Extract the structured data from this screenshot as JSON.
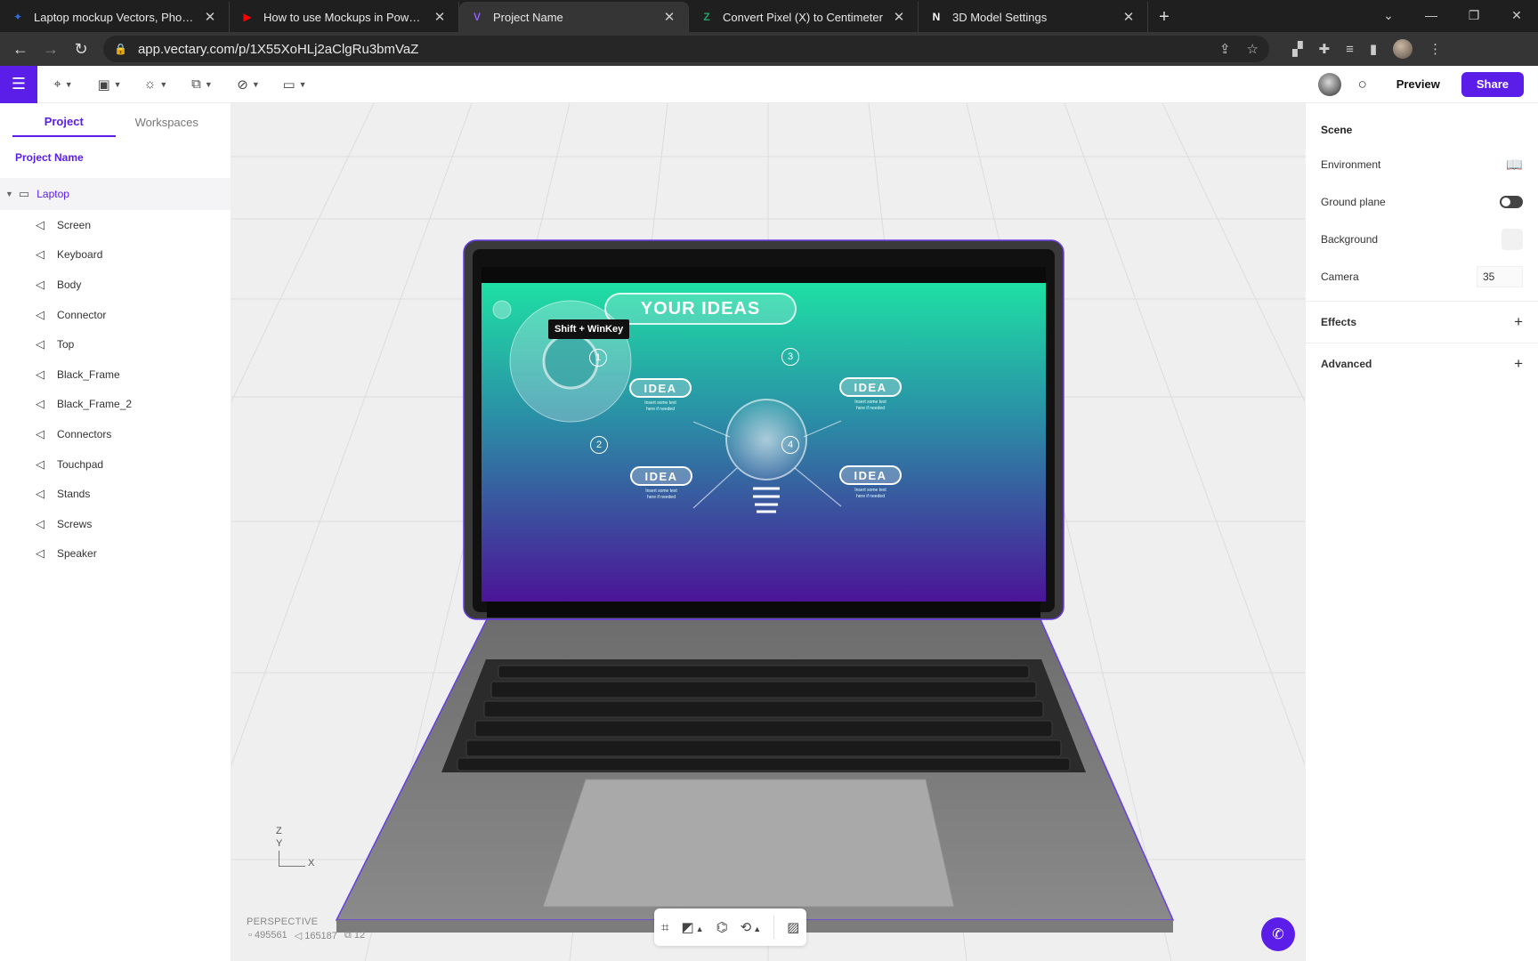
{
  "browser": {
    "tabs": [
      {
        "title": "Laptop mockup Vectors, Photos and",
        "favicon": "globe-icon",
        "color": "#2d6cdf"
      },
      {
        "title": "How to use Mockups in PowerPoint",
        "favicon": "youtube-icon",
        "color": "#ff0000"
      },
      {
        "title": "Project Name",
        "favicon": "vectary-icon",
        "color": "#8b5cf6",
        "active": true
      },
      {
        "title": "Convert Pixel (X) to Centimeter",
        "favicon": "convert-icon",
        "color": "#22a06b"
      },
      {
        "title": "3D Model Settings",
        "favicon": "notion-icon",
        "color": "#ffffff"
      }
    ],
    "url": "app.vectary.com/p/1X55XoHLj2aClgRu3bmVaZ"
  },
  "toolbar": {
    "preview_label": "Preview",
    "share_label": "Share"
  },
  "left_panel": {
    "tabs": [
      "Project",
      "Workspaces"
    ],
    "active_tab": "Project",
    "project_name": "Project Name",
    "root": "Laptop",
    "items": [
      "Screen",
      "Keyboard",
      "Body",
      "Connector",
      "Top",
      "Black_Frame",
      "Black_Frame_2",
      "Connectors",
      "Touchpad",
      "Stands",
      "Screws",
      "Speaker"
    ]
  },
  "viewport": {
    "screen": {
      "title": "YOUR IDEAS",
      "tooltip": "Shift + WinKey",
      "ideas": [
        {
          "num": "1",
          "label": "IDEA",
          "note1": "Insert some text",
          "note2": "here if needed"
        },
        {
          "num": "2",
          "label": "IDEA",
          "note1": "Insert some text",
          "note2": "here if needed"
        },
        {
          "num": "3",
          "label": "IDEA",
          "note1": "Insert some text",
          "note2": "here if needed"
        },
        {
          "num": "4",
          "label": "IDEA",
          "note1": "Insert some text",
          "note2": "here if needed"
        }
      ]
    },
    "axis": {
      "z": "Z",
      "y": "Y",
      "x": "X"
    },
    "perspective_label": "PERSPECTIVE",
    "stats": {
      "vertices": "495561",
      "triangles": "165187",
      "objects": "12"
    }
  },
  "right_panel": {
    "scene_title": "Scene",
    "environment_label": "Environment",
    "ground_plane_label": "Ground plane",
    "background_label": "Background",
    "camera_label": "Camera",
    "camera_value": "35",
    "effects_label": "Effects",
    "advanced_label": "Advanced"
  },
  "colors": {
    "accent": "#5b1de8",
    "screen_top": "#1de9a4",
    "screen_bottom": "#4b1497"
  }
}
